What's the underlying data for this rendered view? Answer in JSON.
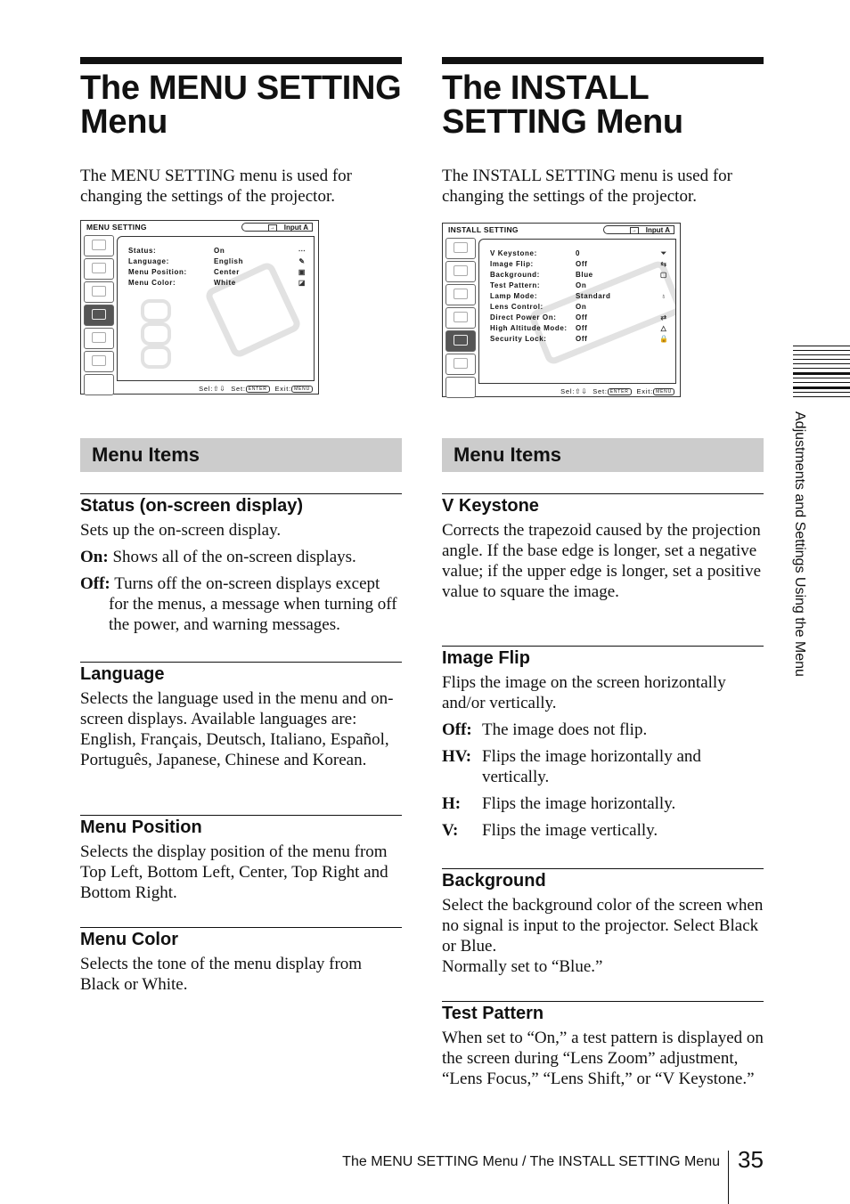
{
  "left": {
    "title_line1": "The MENU SETTING",
    "title_line2": "Menu",
    "intro": "The MENU SETTING menu is used for changing the settings of the projector.",
    "osd": {
      "title": "MENU SETTING",
      "input": "Input A",
      "rows": [
        {
          "label": "Status:",
          "value": "On",
          "icon": "status-icon",
          "glyph": "⋯"
        },
        {
          "label": "Language:",
          "value": "English",
          "icon": "language-icon",
          "glyph": "✎"
        },
        {
          "label": "Menu Position:",
          "value": "Center",
          "icon": "menu-position-icon",
          "glyph": "▣"
        },
        {
          "label": "Menu Color:",
          "value": "White",
          "icon": "menu-color-icon",
          "glyph": "◪"
        }
      ],
      "footer": {
        "sel": "Sel:",
        "sel_keys": "⇧⇩",
        "set": "Set:",
        "set_key": "ENTER",
        "exit": "Exit:",
        "exit_key": "MENU"
      }
    },
    "section": "Menu Items",
    "items": [
      {
        "heading": "Status (on-screen display)",
        "text": "Sets up the on-screen display.",
        "defs": [
          {
            "term": "On:",
            "desc": "Shows all of the on-screen displays."
          },
          {
            "term": "Off:",
            "desc": "Turns off the on-screen displays except for the menus, a message when turning off the power, and warning messages."
          }
        ]
      },
      {
        "heading": "Language",
        "text": "Selects the language used in the menu and on-screen displays. Available languages are: English, Français, Deutsch, Italiano, Español, Português, Japanese, Chinese and Korean."
      },
      {
        "heading": "Menu Position",
        "text": "Selects the display position of the menu from Top Left, Bottom Left, Center, Top Right and Bottom Right."
      },
      {
        "heading": "Menu Color",
        "text": "Selects the tone of the menu display from Black or White."
      }
    ]
  },
  "right": {
    "title_line1": "The INSTALL",
    "title_line2": "SETTING Menu",
    "intro": "The INSTALL SETTING menu is used for changing the settings of the projector.",
    "osd": {
      "title": "INSTALL SETTING",
      "input": "Input A",
      "rows": [
        {
          "label": "V Keystone:",
          "value": "0",
          "icon": "keystone-icon",
          "glyph": "⏷"
        },
        {
          "label": "Image Flip:",
          "value": "Off",
          "icon": "image-flip-icon",
          "glyph": "⇆"
        },
        {
          "label": "Background:",
          "value": "Blue",
          "icon": "background-icon",
          "glyph": "▢"
        },
        {
          "label": "Test Pattern:",
          "value": "On",
          "icon": "",
          "glyph": ""
        },
        {
          "label": "Lamp Mode:",
          "value": "Standard",
          "icon": "lamp-icon",
          "glyph": "♁"
        },
        {
          "label": "Lens Control:",
          "value": "On",
          "icon": "",
          "glyph": ""
        },
        {
          "label": "Direct Power On:",
          "value": "Off",
          "icon": "power-plug-icon",
          "glyph": "⇄"
        },
        {
          "label": "High Altitude Mode:",
          "value": "Off",
          "icon": "mountain-icon",
          "glyph": "△"
        },
        {
          "label": "Security Lock:",
          "value": "Off",
          "icon": "lock-icon",
          "glyph": "🔒"
        }
      ],
      "footer": {
        "sel": "Sel:",
        "sel_keys": "⇧⇩",
        "set": "Set:",
        "set_key": "ENTER",
        "exit": "Exit:",
        "exit_key": "MENU"
      }
    },
    "section": "Menu Items",
    "items": [
      {
        "heading": "V Keystone",
        "text": "Corrects the trapezoid caused by the projection angle. If the base edge is longer, set a negative value; if the upper edge is longer, set a positive value to square the image."
      },
      {
        "heading": "Image Flip",
        "text": "Flips the image on the screen horizontally and/or vertically.",
        "defs": [
          {
            "term": "Off:",
            "desc": "The image does not flip."
          },
          {
            "term": "HV:",
            "desc": "Flips the image horizontally and vertically."
          },
          {
            "term": "H:",
            "desc": "Flips the image horizontally."
          },
          {
            "term": "V:",
            "desc": "Flips the image vertically."
          }
        ]
      },
      {
        "heading": "Background",
        "text": "Select the background color of the screen when no signal is input to the projector. Select Black or Blue.",
        "text2": "Normally set to “Blue.”"
      },
      {
        "heading": "Test Pattern",
        "text": "When set to “On,” a test pattern is displayed on the screen during “Lens Zoom” adjustment, “Lens Focus,” “Lens Shift,” or “V Keystone.”"
      }
    ]
  },
  "side_tab": "Adjustments and Settings Using the Menu",
  "footer": {
    "running_title": "The MENU SETTING Menu / The INSTALL SETTING Menu",
    "page_number": "35"
  }
}
